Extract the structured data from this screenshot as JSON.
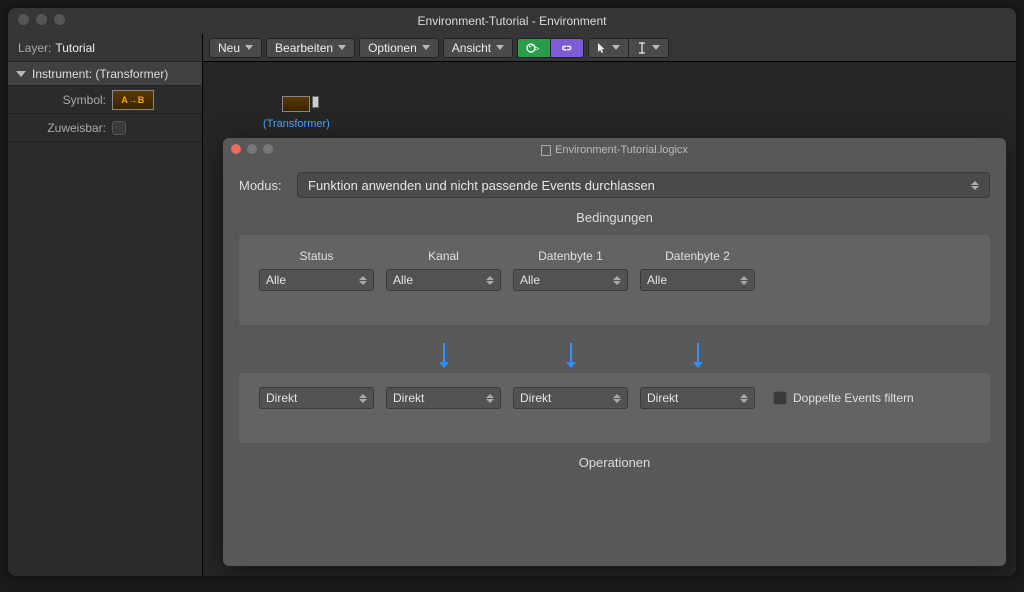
{
  "window": {
    "title": "Environment-Tutorial - Environment"
  },
  "sidebar": {
    "layer_label": "Layer:",
    "layer_value": "Tutorial",
    "section_label": "Instrument: (Transformer)",
    "symbol_label": "Symbol:",
    "symbol_text": "A→B",
    "assignable_label": "Zuweisbar:"
  },
  "toolbar": {
    "new": "Neu",
    "edit": "Bearbeiten",
    "options": "Optionen",
    "view": "Ansicht"
  },
  "canvas": {
    "node_name": "(Transformer)"
  },
  "sheet": {
    "title": "Environment-Tutorial.logicx",
    "modus_label": "Modus:",
    "modus_value": "Funktion anwenden und nicht passende Events durchlassen",
    "conditions_title": "Bedingungen",
    "columns": {
      "status": "Status",
      "kanal": "Kanal",
      "db1": "Datenbyte 1",
      "db2": "Datenbyte 2"
    },
    "cond_values": {
      "status": "Alle",
      "kanal": "Alle",
      "db1": "Alle",
      "db2": "Alle"
    },
    "ops_values": {
      "status": "Direkt",
      "kanal": "Direkt",
      "db1": "Direkt",
      "db2": "Direkt"
    },
    "filter_label": "Doppelte Events filtern",
    "operations_title": "Operationen"
  }
}
